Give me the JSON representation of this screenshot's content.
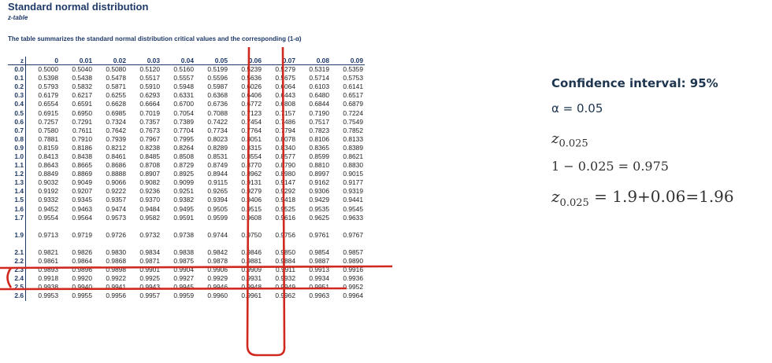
{
  "header": {
    "title": "Standard normal distribution",
    "subtitle": "z-table",
    "description": "The table summarizes the standard normal distribution critical values and the corresponding (1-α)"
  },
  "table": {
    "corner": "z",
    "columns": [
      "0",
      "0.01",
      "0.02",
      "0.03",
      "0.04",
      "0.05",
      "0.06",
      "0.07",
      "0.08",
      "0.09"
    ],
    "rows": [
      {
        "z": "0.0",
        "v": [
          "0.5000",
          "0.5040",
          "0.5080",
          "0.5120",
          "0.5160",
          "0.5199",
          "0.5239",
          "0.5279",
          "0.5319",
          "0.5359"
        ]
      },
      {
        "z": "0.1",
        "v": [
          "0.5398",
          "0.5438",
          "0.5478",
          "0.5517",
          "0.5557",
          "0.5596",
          "0.5636",
          "0.5675",
          "0.5714",
          "0.5753"
        ]
      },
      {
        "z": "0.2",
        "v": [
          "0.5793",
          "0.5832",
          "0.5871",
          "0.5910",
          "0.5948",
          "0.5987",
          "0.6026",
          "0.6064",
          "0.6103",
          "0.6141"
        ]
      },
      {
        "z": "0.3",
        "v": [
          "0.6179",
          "0.6217",
          "0.6255",
          "0.6293",
          "0.6331",
          "0.6368",
          "0.6406",
          "0.6443",
          "0.6480",
          "0.6517"
        ]
      },
      {
        "z": "0.4",
        "v": [
          "0.6554",
          "0.6591",
          "0.6628",
          "0.6664",
          "0.6700",
          "0.6736",
          "0.6772",
          "0.6808",
          "0.6844",
          "0.6879"
        ]
      },
      {
        "z": "0.5",
        "v": [
          "0.6915",
          "0.6950",
          "0.6985",
          "0.7019",
          "0.7054",
          "0.7088",
          "0.7123",
          "0.7157",
          "0.7190",
          "0.7224"
        ]
      },
      {
        "z": "0.6",
        "v": [
          "0.7257",
          "0.7291",
          "0.7324",
          "0.7357",
          "0.7389",
          "0.7422",
          "0.7454",
          "0.7486",
          "0.7517",
          "0.7549"
        ]
      },
      {
        "z": "0.7",
        "v": [
          "0.7580",
          "0.7611",
          "0.7642",
          "0.7673",
          "0.7704",
          "0.7734",
          "0.7764",
          "0.7794",
          "0.7823",
          "0.7852"
        ]
      },
      {
        "z": "0.8",
        "v": [
          "0.7881",
          "0.7910",
          "0.7939",
          "0.7967",
          "0.7995",
          "0.8023",
          "0.8051",
          "0.8078",
          "0.8106",
          "0.8133"
        ]
      },
      {
        "z": "0.9",
        "v": [
          "0.8159",
          "0.8186",
          "0.8212",
          "0.8238",
          "0.8264",
          "0.8289",
          "0.8315",
          "0.8340",
          "0.8365",
          "0.8389"
        ]
      },
      {
        "z": "1.0",
        "v": [
          "0.8413",
          "0.8438",
          "0.8461",
          "0.8485",
          "0.8508",
          "0.8531",
          "0.8554",
          "0.8577",
          "0.8599",
          "0.8621"
        ]
      },
      {
        "z": "1.1",
        "v": [
          "0.8643",
          "0.8665",
          "0.8686",
          "0.8708",
          "0.8729",
          "0.8749",
          "0.8770",
          "0.8790",
          "0.8810",
          "0.8830"
        ]
      },
      {
        "z": "1.2",
        "v": [
          "0.8849",
          "0.8869",
          "0.8888",
          "0.8907",
          "0.8925",
          "0.8944",
          "0.8962",
          "0.8980",
          "0.8997",
          "0.9015"
        ]
      },
      {
        "z": "1.3",
        "v": [
          "0.9032",
          "0.9049",
          "0.9066",
          "0.9082",
          "0.9099",
          "0.9115",
          "0.9131",
          "0.9147",
          "0.9162",
          "0.9177"
        ]
      },
      {
        "z": "1.4",
        "v": [
          "0.9192",
          "0.9207",
          "0.9222",
          "0.9236",
          "0.9251",
          "0.9265",
          "0.9279",
          "0.9292",
          "0.9306",
          "0.9319"
        ]
      },
      {
        "z": "1.5",
        "v": [
          "0.9332",
          "0.9345",
          "0.9357",
          "0.9370",
          "0.9382",
          "0.9394",
          "0.9406",
          "0.9418",
          "0.9429",
          "0.9441"
        ]
      },
      {
        "z": "1.6",
        "v": [
          "0.9452",
          "0.9463",
          "0.9474",
          "0.9484",
          "0.9495",
          "0.9505",
          "0.9515",
          "0.9525",
          "0.9535",
          "0.9545"
        ]
      },
      {
        "z": "1.7",
        "v": [
          "0.9554",
          "0.9564",
          "0.9573",
          "0.9582",
          "0.9591",
          "0.9599",
          "0.9608",
          "0.9616",
          "0.9625",
          "0.9633"
        ]
      },
      {
        "z": "",
        "v": [
          "",
          "",
          "",
          "",
          "",
          "",
          "",
          "",
          "",
          ""
        ]
      },
      {
        "z": "1.9",
        "v": [
          "0.9713",
          "0.9719",
          "0.9726",
          "0.9732",
          "0.9738",
          "0.9744",
          "0.9750",
          "0.9756",
          "0.9761",
          "0.9767"
        ]
      },
      {
        "z": "",
        "v": [
          "",
          "",
          "",
          "",
          "",
          "",
          "",
          "",
          "",
          ""
        ]
      },
      {
        "z": "2.1",
        "v": [
          "0.9821",
          "0.9826",
          "0.9830",
          "0.9834",
          "0.9838",
          "0.9842",
          "0.9846",
          "0.9850",
          "0.9854",
          "0.9857"
        ]
      },
      {
        "z": "2.2",
        "v": [
          "0.9861",
          "0.9864",
          "0.9868",
          "0.9871",
          "0.9875",
          "0.9878",
          "0.9881",
          "0.9884",
          "0.9887",
          "0.9890"
        ]
      },
      {
        "z": "2.3",
        "v": [
          "0.9893",
          "0.9896",
          "0.9898",
          "0.9901",
          "0.9904",
          "0.9906",
          "0.9909",
          "0.9911",
          "0.9913",
          "0.9916"
        ]
      },
      {
        "z": "2.4",
        "v": [
          "0.9918",
          "0.9920",
          "0.9922",
          "0.9925",
          "0.9927",
          "0.9929",
          "0.9931",
          "0.9932",
          "0.9934",
          "0.9936"
        ]
      },
      {
        "z": "2.5",
        "v": [
          "0.9938",
          "0.9940",
          "0.9941",
          "0.9943",
          "0.9945",
          "0.9946",
          "0.9948",
          "0.9949",
          "0.9951",
          "0.9952"
        ]
      },
      {
        "z": "2.6",
        "v": [
          "0.9953",
          "0.9955",
          "0.9956",
          "0.9957",
          "0.9959",
          "0.9960",
          "0.9961",
          "0.9962",
          "0.9963",
          "0.9964"
        ]
      }
    ]
  },
  "notes": {
    "ci": "Confidence interval: 95%",
    "alpha": "α = 0.05",
    "z_letter": "z",
    "z_sub": "0.025",
    "calc": "1 − 0.025 = 0.975",
    "result_letter": "z",
    "result_sub": "0.025",
    "result_rest": " = 1.9+0.06=1.96"
  },
  "colors": {
    "annotation": "#d0281f",
    "heading": "#1f3a68"
  }
}
